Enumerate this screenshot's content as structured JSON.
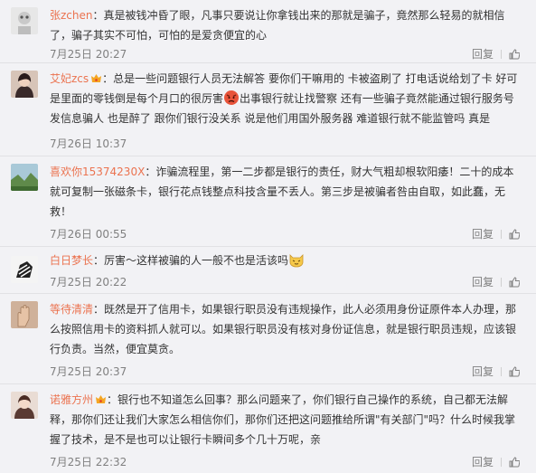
{
  "comments": [
    {
      "user": "张zchen",
      "separator": "：",
      "text": "真是被钱冲昏了眼，凡事只要说让你拿钱出来的那就是骗子，竟然那么轻易的就相信了，骗子其实不可怕，可怕的是爱贪便宜的心",
      "time": "7月25日 20:27",
      "reply": "回复",
      "avatar_icon": "robot-avatar-icon",
      "vip": false
    },
    {
      "user": "艾妃zcs",
      "separator": "：",
      "text_before": "总是一些问题银行人员无法解答 要你们干嘛用的 卡被盗刷了 打电话说给划了卡 好可是里面的零钱倒是每个月口的很厉害",
      "emoji": "angry-emoji-icon",
      "text_after": "出事银行就让找警察 还有一些骗子竟然能通过银行服务号发信息骗人 也是醉了 跟你们银行没关系 说是他们用国外服务器 难道银行就不能监管吗 真是",
      "time": "7月26日 10:37",
      "reply": "回复",
      "avatar_icon": "woman-avatar-icon",
      "vip": true
    },
    {
      "user": "喜欢你15374230X",
      "separator": "：",
      "text": "诈骗流程里，第一二步都是银行的责任，财大气粗却根软阳痿！二十的成本就可复制一张磁条卡，银行花点钱整点科技含量不丢人。第三步是被骗者咎由自取，如此蠢，无救！",
      "time": "7月26日 00:55",
      "reply": "回复",
      "avatar_icon": "landscape-avatar-icon",
      "vip": false
    },
    {
      "user": "白日梦长",
      "separator": "：",
      "text_before": "厉害～这样被骗的人一般不也是活该吗",
      "emoji": "cat-emoji-icon",
      "text_after": "",
      "time": "7月25日 20:22",
      "reply": "回复",
      "avatar_icon": "zebra-avatar-icon",
      "vip": false
    },
    {
      "user": "等待清清",
      "separator": "：",
      "text": "既然是开了信用卡，如果银行职员没有违规操作，此人必须用身份证原件本人办理，那么按照信用卡的资料抓人就可以。如果银行职员没有核对身份证信息，就是银行职员违规，应该银行负责。当然，便宜莫贪。",
      "time": "7月25日 20:37",
      "reply": "回复",
      "avatar_icon": "hand-avatar-icon",
      "vip": false
    },
    {
      "user": "诺雅方州",
      "separator": "：",
      "text": "银行也不知道怎么回事？那么问题来了，你们银行自己操作的系统，自己都无法解释，那你们还让我们大家怎么相信你们，那你们还把这问题推给所谓\"有关部门\"吗？什么时候我掌握了技术，是不是也可以让银行卡瞬间多个几十万呢，亲",
      "time": "7月25日 22:32",
      "reply": "回复",
      "avatar_icon": "girl-avatar-icon",
      "vip": true
    }
  ],
  "colors": {
    "username": "#eb7350",
    "meta": "#808080",
    "background": "#f2f2f5"
  }
}
